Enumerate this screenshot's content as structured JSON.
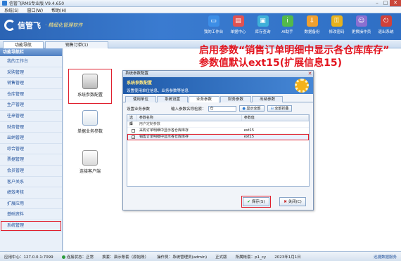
{
  "window": {
    "title": "信管飞RMS专业版 V9.4.650"
  },
  "menu": [
    "系统(S)",
    "窗口(W)",
    "帮助(H)"
  ],
  "brand": {
    "name": "信管飞",
    "slogan": "· 精细化管理软件"
  },
  "toolbar": [
    {
      "label": "我的工作台",
      "icon": "desktop-icon",
      "color": "#3d8ee6"
    },
    {
      "label": "单据中心",
      "icon": "document-icon",
      "color": "#e05252"
    },
    {
      "label": "库存查询",
      "icon": "box-icon",
      "color": "#3fb0d9"
    },
    {
      "label": "AI助手",
      "icon": "info-icon",
      "color": "#53b94a"
    },
    {
      "label": "数据备份",
      "icon": "backup-icon",
      "color": "#f0a030"
    },
    {
      "label": "修改密码",
      "icon": "lock-icon",
      "color": "#e8b21c"
    },
    {
      "label": "更换操作员",
      "icon": "user-icon",
      "color": "#8a6fd1"
    },
    {
      "label": "退出系统",
      "icon": "power-icon",
      "color": "#d0413a"
    }
  ],
  "tabs": [
    "功能导航",
    "销售订单(1)"
  ],
  "sidebar": {
    "header": "功能导航栏",
    "items": [
      "我的工作台",
      "采购管理",
      "销售管理",
      "仓库管理",
      "生产管理",
      "往来管理",
      "财务管理",
      "出纳管理",
      "综合管理",
      "票据管理",
      "会员管理",
      "客户关系",
      "绩效考核",
      "扩展应用",
      "基础资料",
      "系统管理"
    ]
  },
  "functions": [
    "系统参数配置",
    "单据业务参数",
    "连接客户端"
  ],
  "annotation": {
    "line1": "启用参数“销售订单明细中显示各仓库库存”",
    "line2": "参数值默认ext15(扩展信息15)"
  },
  "dialog": {
    "title": "系统参数配置",
    "banner_title": "系统参数配置",
    "banner_desc": "设置使用单位信息、业务参数等信息",
    "tabs": [
      "使用单位",
      "系统设置",
      "业务参数",
      "财务参数",
      "出纳参数"
    ],
    "active_tab": 2,
    "search_label": "设置业务参数",
    "search_field_label": "输入参数名称检索：",
    "search_value": "仓",
    "show_all_label": "显示全部",
    "collapse_label": "全部折叠",
    "columns": [
      "选择",
      "参数名称",
      "参数值"
    ],
    "rows": [
      {
        "type": "group",
        "name": "用户定制参数",
        "value": ""
      },
      {
        "type": "item",
        "checked": false,
        "name": "采购订单明细中显示各仓库库存",
        "value": "ext15"
      },
      {
        "type": "item",
        "checked": true,
        "name": "销售订单明细中显示各仓库库存",
        "value": "ext15"
      }
    ],
    "ok_label": "保存(S)",
    "cancel_label": "关闭(C)"
  },
  "statusbar": {
    "server": "应用中心：127.0.0.1:7099",
    "conn": "连接状态：正常",
    "mode": "换套：演示账套（原始账）",
    "operator": "操作员：系统管理员(admin)",
    "version": "正式版",
    "account": "所属帐套：p1_cy",
    "date": "2023年1月1日",
    "link": "迅捷数据服务"
  }
}
